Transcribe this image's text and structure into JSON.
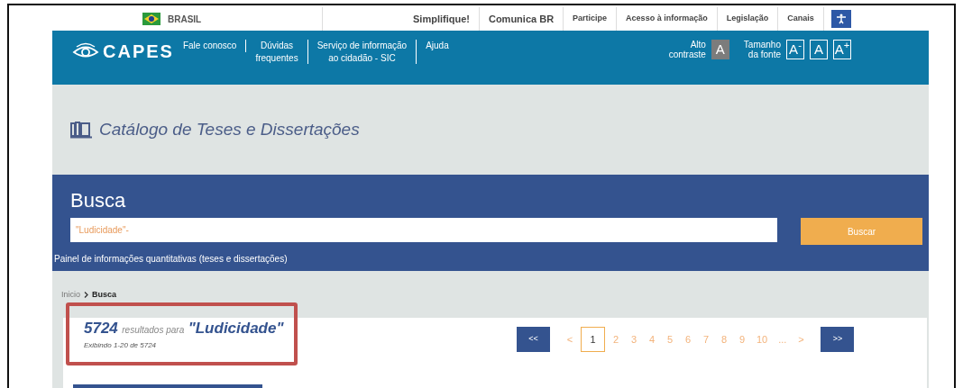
{
  "gov_bar": {
    "country": "BRASIL",
    "links": [
      "Simplifique!",
      "Comunica BR",
      "Participe",
      "Acesso à informação",
      "Legislação",
      "Canais"
    ]
  },
  "header": {
    "logo": "CAPES",
    "nav": [
      {
        "lines": [
          "Fale conosco"
        ]
      },
      {
        "lines": [
          "Dúvidas",
          "frequentes"
        ]
      },
      {
        "lines": [
          "Serviço de informação",
          "ao cidadão - SIC"
        ]
      },
      {
        "lines": [
          "Ajuda"
        ]
      }
    ],
    "contrast_label": [
      "Alto",
      "contraste"
    ],
    "contrast_button": "A",
    "font_label": [
      "Tamanho",
      "da fonte"
    ],
    "font_buttons": [
      "A$^{-}$",
      "A",
      "A$^{+}$"
    ]
  },
  "catalog_title": "Catálogo de Teses e Dissertações",
  "search": {
    "heading": "Busca",
    "value": "\"Ludicidade\"-",
    "button": "Buscar",
    "panel_link": "Painel de informações quantitativas (teses e dissertações)"
  },
  "breadcrumb": [
    {
      "label": "Inicio",
      "current": false
    },
    {
      "label": "Busca",
      "current": true
    }
  ],
  "results": {
    "count": "5724",
    "label": "resultados para",
    "query": "\"Ludicidade\"",
    "showing": "Exibindo 1-20 de 5724",
    "highlighted": true
  },
  "pagination": {
    "first": "<<",
    "prev": "<",
    "pages": [
      {
        "label": "1",
        "selected": true
      },
      {
        "label": "2",
        "selected": false
      },
      {
        "label": "3",
        "selected": false
      },
      {
        "label": "4",
        "selected": false
      },
      {
        "label": "5",
        "selected": false
      },
      {
        "label": "6",
        "selected": false
      },
      {
        "label": "7",
        "selected": false
      },
      {
        "label": "8",
        "selected": false
      },
      {
        "label": "9",
        "selected": false
      },
      {
        "label": "10",
        "selected": false
      }
    ],
    "ellipsis": "...",
    "next": ">",
    "last": ">>"
  }
}
